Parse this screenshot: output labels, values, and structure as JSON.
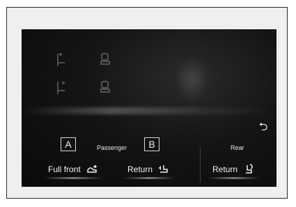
{
  "labels": {
    "badge_a": "A",
    "badge_b": "B",
    "passenger": "Passenger",
    "rear": "Rear"
  },
  "buttons": {
    "full_front": "Full front",
    "return_passenger": "Return",
    "return_rear": "Return"
  },
  "icons": {
    "back": "return-arrow-icon",
    "seat_dim": "seat-icon",
    "full_front": "seat-forward-icon",
    "return_passenger": "seat-return-icon",
    "return_rear": "seat-recline-icon"
  }
}
